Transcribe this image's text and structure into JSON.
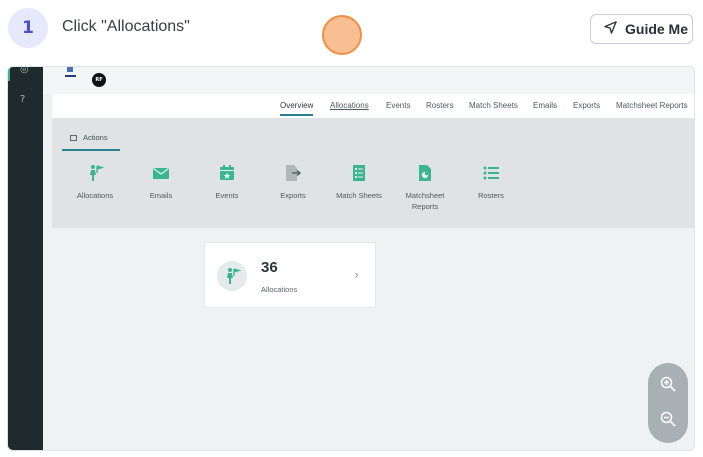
{
  "step": {
    "number": "1",
    "instruction": "Click \"Allocations\""
  },
  "guide_button": {
    "label": "Guide Me"
  },
  "app": {
    "sidebar": {
      "icons": [
        "settings-icon",
        "help-icon"
      ],
      "help_glyph": "?"
    },
    "avatar": {
      "initials": "RF"
    },
    "tabs": [
      {
        "label": "Overview"
      },
      {
        "label": "Allocations"
      },
      {
        "label": "Events"
      },
      {
        "label": "Rosters"
      },
      {
        "label": "Match Sheets"
      },
      {
        "label": "Emails"
      },
      {
        "label": "Exports"
      },
      {
        "label": "Matchsheet Reports"
      }
    ],
    "actions_tab": {
      "label": "Actions"
    },
    "actions": [
      {
        "label": "Allocations",
        "icon": "person-flag-icon"
      },
      {
        "label": "Emails",
        "icon": "envelope-icon"
      },
      {
        "label": "Events",
        "icon": "calendar-icon"
      },
      {
        "label": "Exports",
        "icon": "export-icon"
      },
      {
        "label": "Match Sheets",
        "icon": "sheet-icon"
      },
      {
        "label": "Matchsheet Reports",
        "icon": "report-icon"
      },
      {
        "label": "Rosters",
        "icon": "list-icon"
      }
    ],
    "stat": {
      "value": "36",
      "label": "Allocations",
      "chevron": "›"
    }
  },
  "colors": {
    "accent_green": "#3bb58d",
    "highlight": "#f4a062",
    "sidebar": "#1f2a2c"
  }
}
